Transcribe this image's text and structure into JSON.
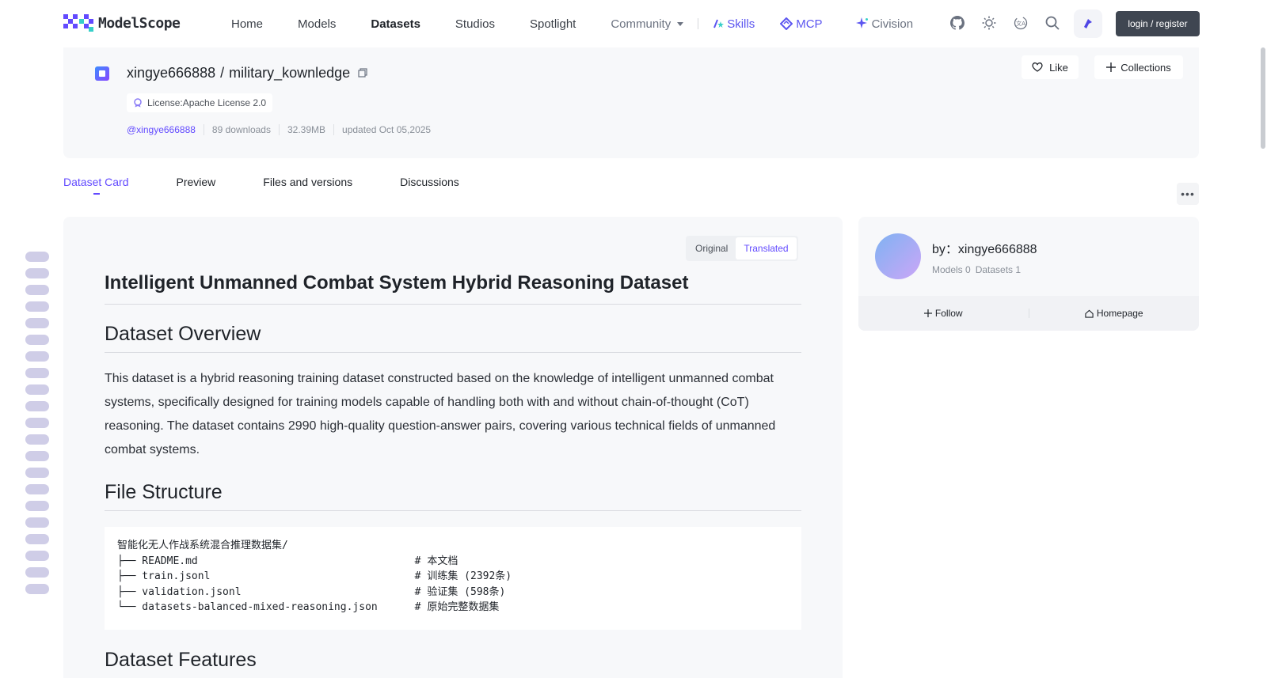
{
  "nav": {
    "logo_text": "ModelScope",
    "links": [
      "Home",
      "Models",
      "Datasets",
      "Studios",
      "Spotlight"
    ],
    "community_label": "Community",
    "skills_label": "Skills",
    "mcp_label": "MCP",
    "civision_label": "Civision",
    "login_label": "login / register"
  },
  "header": {
    "owner": "xingye666888",
    "separator": "/",
    "name": "military_kownledge",
    "license": "License:Apache License 2.0",
    "author_handle": "@xingye666888",
    "downloads": "89 downloads",
    "size": "32.39MB",
    "updated": "updated Oct 05,2025",
    "like_label": "Like",
    "collections_label": "Collections"
  },
  "tabs": [
    "Dataset Card",
    "Preview",
    "Files and versions",
    "Discussions"
  ],
  "content": {
    "toggle_original": "Original",
    "toggle_translated": "Translated",
    "title": "Intelligent Unmanned Combat System Hybrid Reasoning Dataset",
    "overview_heading": "Dataset Overview",
    "overview_text": "This dataset is a hybrid reasoning training dataset constructed based on the knowledge of intelligent unmanned combat systems, specifically designed for training models capable of handling both with and without chain-of-thought (CoT) reasoning. The dataset contains 2990 high-quality question-answer pairs, covering various technical fields of unmanned combat systems.",
    "structure_heading": "File Structure",
    "code_block": "智能化无人作战系统混合推理数据集/\n├── README.md                                   # 本文档\n├── train.jsonl                                 # 训练集 (2392条)\n├── validation.jsonl                            # 验证集 (598条)\n└── datasets-balanced-mixed-reasoning.json      # 原始完整数据集",
    "features_heading": "Dataset Features"
  },
  "author": {
    "by_label": "by：xingye666888",
    "models": "Models 0",
    "datasets": "Datasets 1",
    "follow_label": "Follow",
    "homepage_label": "Homepage"
  },
  "colors": {
    "accent": "#624aff",
    "login_bg": "#3f4651",
    "card_bg": "#f7f8fa"
  }
}
